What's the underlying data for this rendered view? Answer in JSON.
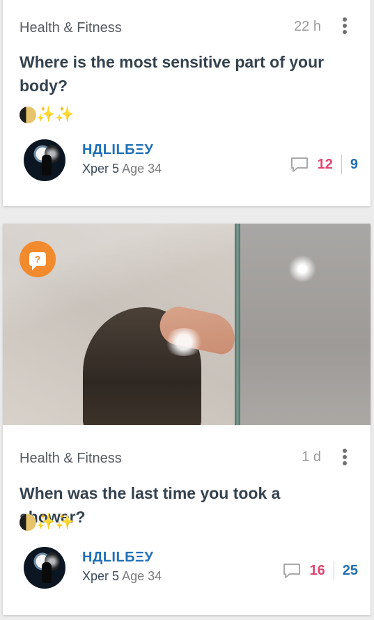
{
  "posts": [
    {
      "category": "Health & Fitness",
      "time": "22 h",
      "title": "Where is the most sensitive part of your body?",
      "emoji": "🌗✨✨",
      "user": {
        "name": "НДLILБΞУ",
        "xp_label": "Xper 5",
        "age_label": "Age 34"
      },
      "answers": "12",
      "views": "9",
      "has_image": false
    },
    {
      "category": "Health & Fitness",
      "time": "1 d",
      "title": "When was the last time you took a shower?",
      "emoji": "🌗✨✨",
      "user": {
        "name": "НДLILБΞУ",
        "xp_label": "Xper 5",
        "age_label": "Age 34"
      },
      "answers": "16",
      "views": "25",
      "has_image": true,
      "image_badge": "?"
    }
  ],
  "icons": {
    "more": "more-vertical-icon",
    "comment": "comment-bubble-icon",
    "question": "question-bubble-icon"
  },
  "colors": {
    "username": "#1e6fb8",
    "answers": "#e2466e",
    "views": "#1e6fb8",
    "question_badge": "#f28a2e"
  }
}
